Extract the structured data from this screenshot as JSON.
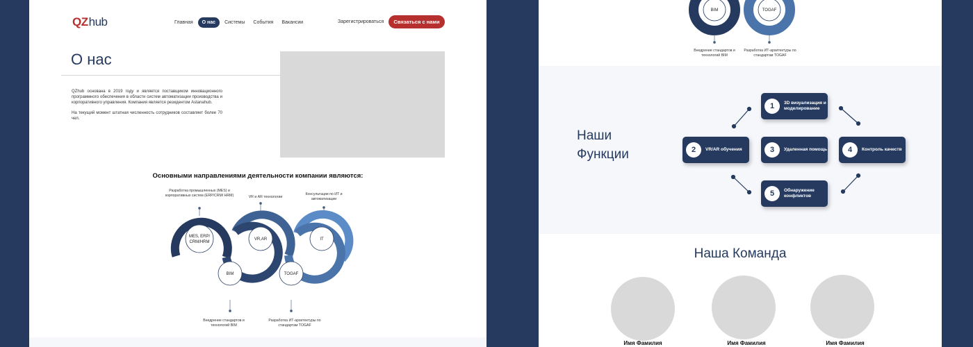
{
  "header": {
    "logo_main": "QZ",
    "logo_sub": "hub",
    "nav": [
      "Главная",
      "О нас",
      "Системы",
      "События",
      "Вакансии"
    ],
    "active_nav": "О нас",
    "register": "Зарегистрироваться",
    "contact": "Связаться с нами"
  },
  "about": {
    "title": "О нас",
    "paragraph1": "QZhub основана в 2019 году и является поставщиком инновационного программного обеспечения в области систем автоматизации производства и корпоративного управления. Компания является резидентом Astanahub.",
    "paragraph2": "На текущий момент штатная численность сотрудников составляет более 70 чел."
  },
  "directions": {
    "title": "Основными направлениями деятельности компании являются:",
    "top_labels": [
      "Разработка промышленных (MES) и корпоративных систем (ERP/CRM/ HRM)",
      "VR и AR технологии",
      "Консультации по ИТ и автоматизации"
    ],
    "bottom_labels": [
      "Внедрение стандартов и технологий BIM",
      "Разработка ИТ-архитектуры по стандартам TOGAF"
    ],
    "rings": [
      "MES, ERP/ CRM/HRM",
      "BIM",
      "VR,AR",
      "TOGAF",
      "IT"
    ]
  },
  "right_top": {
    "rings": [
      "BIM",
      "TOGAF"
    ],
    "captions": [
      "Внедрение стандартов и технологий BIM",
      "Разработка ИТ-архитектуры по стандартам TOGAF"
    ]
  },
  "functions": {
    "title_line1": "Наши",
    "title_line2": "Функции",
    "items": [
      {
        "num": "1",
        "label": "3D визуализация и моделирование"
      },
      {
        "num": "2",
        "label": "VR/AR обучения"
      },
      {
        "num": "3",
        "label": "Удаленная помощь"
      },
      {
        "num": "4",
        "label": "Контроль качеств"
      },
      {
        "num": "5",
        "label": "Обнаружение конфликтов"
      }
    ]
  },
  "team": {
    "title": "Наша Команда",
    "members": [
      "Имя Фамилия",
      "Имя Фамилия",
      "Имя Фамилия"
    ]
  },
  "colors": {
    "navy": "#253a5e",
    "mid_blue": "#3d6293",
    "light_blue": "#5b8cc7",
    "accent_red": "#b5302f"
  }
}
